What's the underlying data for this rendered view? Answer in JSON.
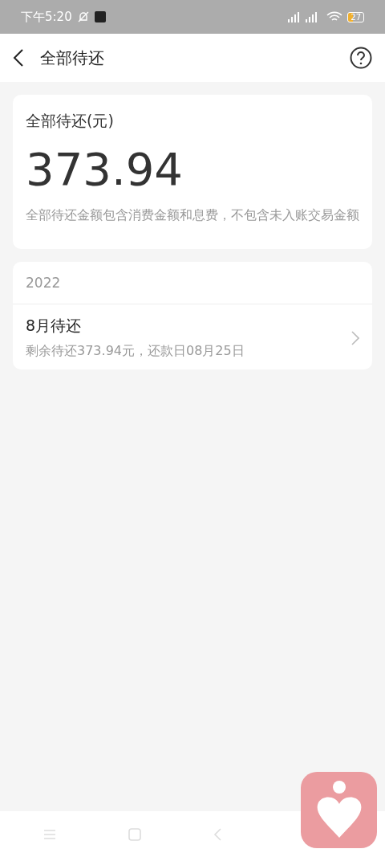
{
  "status_bar": {
    "time": "下午5:20",
    "battery": "27"
  },
  "header": {
    "title": "全部待还"
  },
  "summary": {
    "label": "全部待还(元)",
    "amount": "373.94",
    "note": "全部待还金额包含消费金额和息费，不包含未入账交易金额"
  },
  "bills": {
    "year": "2022",
    "items": [
      {
        "title": "8月待还",
        "detail": "剩余待还373.94元，还款日08月25日"
      }
    ]
  }
}
